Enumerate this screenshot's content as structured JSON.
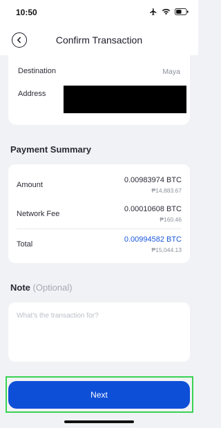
{
  "status_bar": {
    "time": "10:50",
    "icons": [
      "airplane-icon",
      "wifi-icon",
      "battery-icon"
    ]
  },
  "header": {
    "title": "Confirm Transaction",
    "back_icon": "back-icon"
  },
  "destination_card": {
    "destination_label": "Destination",
    "destination_value": "Maya",
    "address_label": "Address"
  },
  "payment_summary": {
    "title": "Payment Summary",
    "rows": [
      {
        "label": "Amount",
        "btc": "0.00983974 BTC",
        "php": "₱14,883.67"
      },
      {
        "label": "Network Fee",
        "btc": "0.00010608 BTC",
        "php": "₱160.46"
      },
      {
        "label": "Total",
        "btc": "0.00994582 BTC",
        "php": "₱15,044.13"
      }
    ]
  },
  "note": {
    "title": "Note",
    "optional": "(Optional)",
    "placeholder": "What's the transaction for?"
  },
  "actions": {
    "next_label": "Next"
  },
  "colors": {
    "accent": "#0e4fd8",
    "total_text": "#1a56db",
    "highlight": "#39d353"
  }
}
